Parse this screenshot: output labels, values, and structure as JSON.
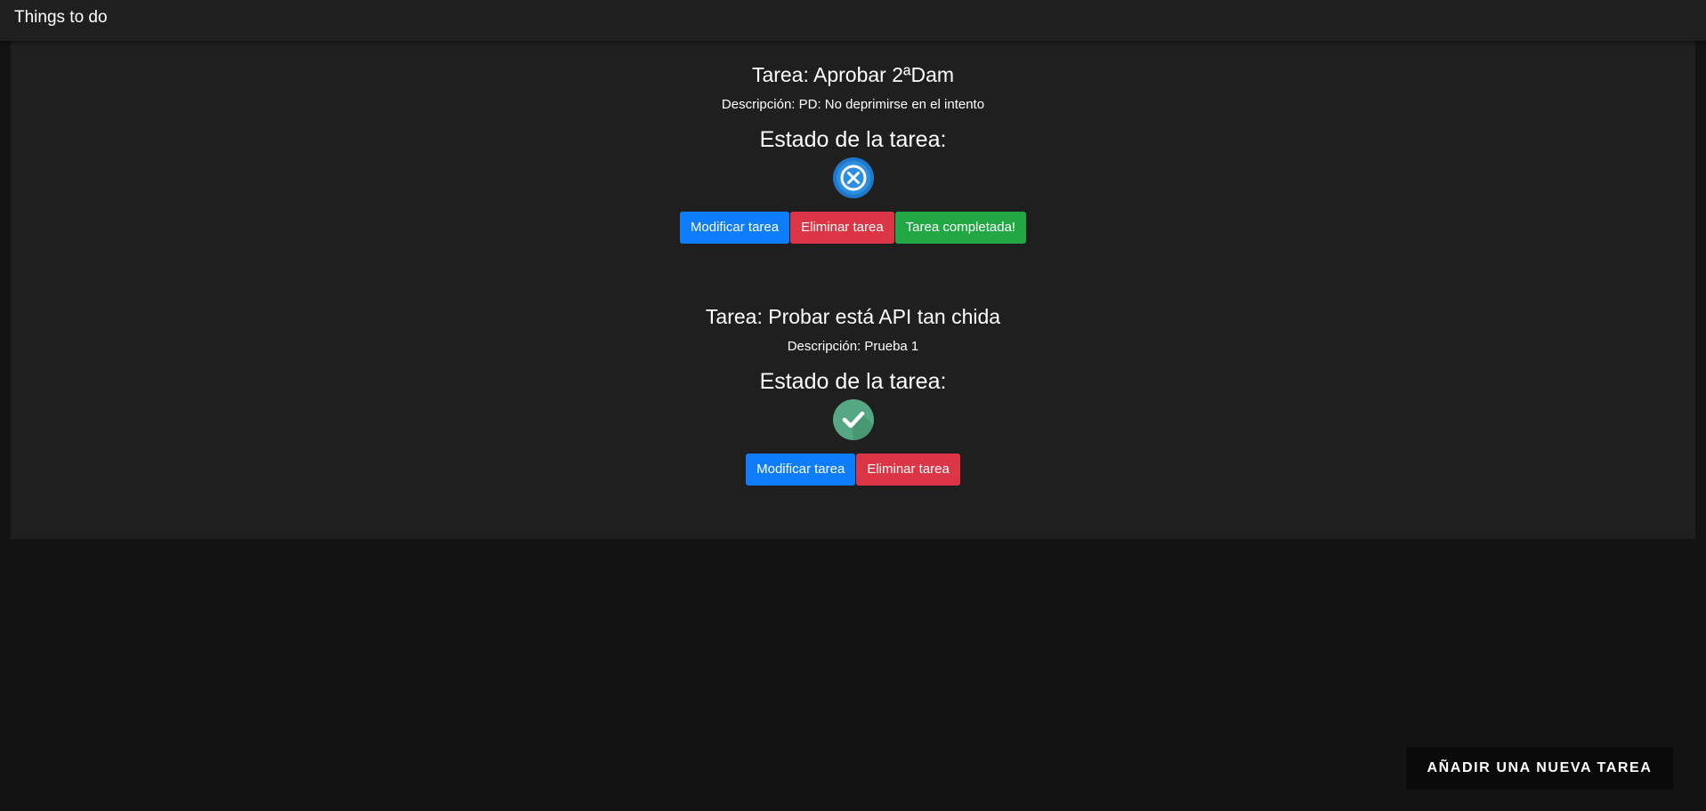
{
  "app": {
    "title": "Things to do"
  },
  "tasks": [
    {
      "title": "Tarea: Aprobar 2ªDam",
      "description": "Descripción: PD: No deprimirse en el intento",
      "status_heading": "Estado de la tarea:",
      "status_icon": "x-circle-icon",
      "status_color": "#1f78c9",
      "buttons": {
        "modify": "Modificar tarea",
        "delete": "Eliminar tarea",
        "complete": "Tarea completada!"
      }
    },
    {
      "title": "Tarea: Probar está API tan chida",
      "description": "Descripción: Prueba 1",
      "status_heading": "Estado de la tarea:",
      "status_icon": "check-circle-icon",
      "status_color": "#55a882",
      "buttons": {
        "modify": "Modificar tarea",
        "delete": "Eliminar tarea"
      }
    }
  ],
  "add_task_button": "AÑADIR UNA NUEVA TAREA"
}
